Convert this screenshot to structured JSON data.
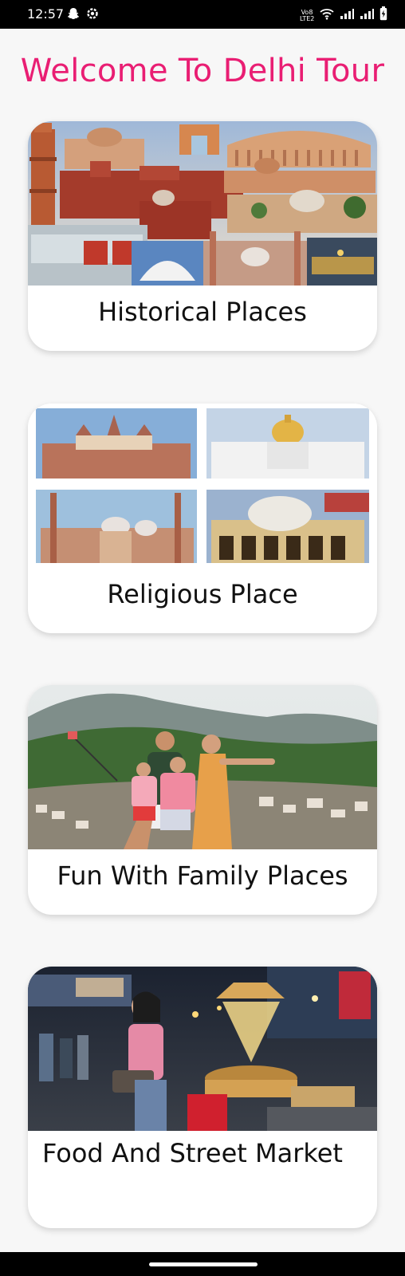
{
  "status_bar": {
    "time": "12:57",
    "network_label_top": "Vo8",
    "network_label_bottom": "LTE2",
    "colors": {
      "background": "#000000",
      "foreground": "#ffffff"
    }
  },
  "page_title": "Welcome To Delhi Tour",
  "colors": {
    "title": "#e91e73",
    "page_bg": "#f7f7f7",
    "card_bg": "#ffffff"
  },
  "cards": [
    {
      "label": "Historical Places",
      "image": "delhi-historical-monuments-collage"
    },
    {
      "label": "Religious Place",
      "image": "delhi-religious-places-collage"
    },
    {
      "label": "Fun With Family Places",
      "image": "family-selfie-hills-photo"
    },
    {
      "label": "Food And Street Market",
      "image": "night-street-market-photo"
    }
  ],
  "icons": [
    "snapchat-icon",
    "settings-icon",
    "wifi-icon",
    "signal-icon",
    "battery-icon"
  ]
}
